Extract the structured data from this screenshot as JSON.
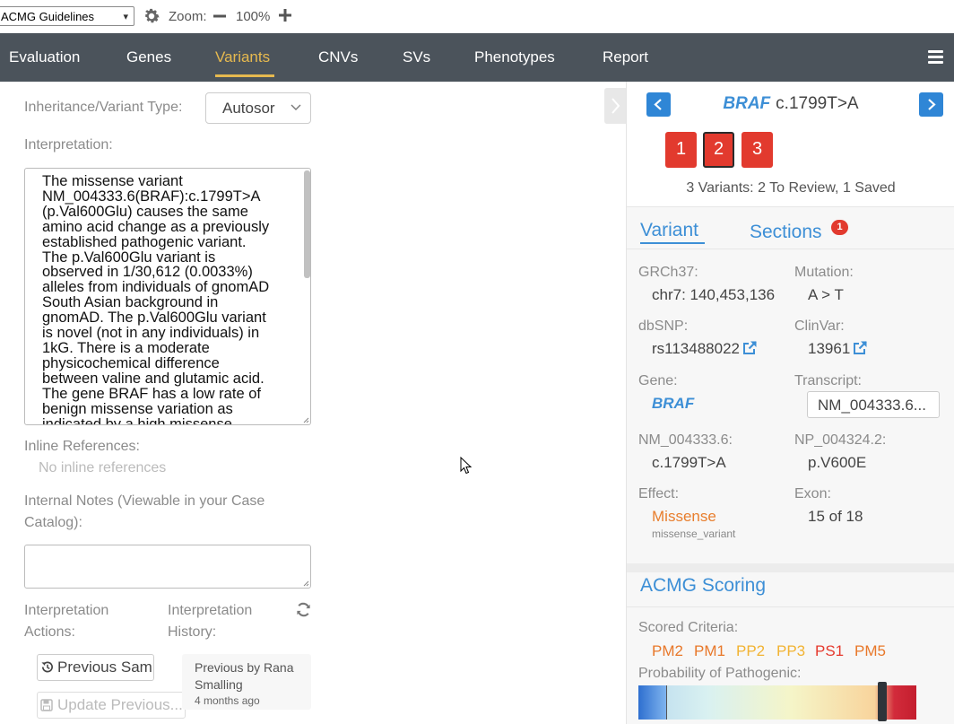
{
  "toolbar": {
    "guideline_select_value": "ACMG Guidelines",
    "zoom_label": "Zoom:",
    "zoom_value": "100%"
  },
  "nav": {
    "items": [
      "Evaluation",
      "Genes",
      "Variants",
      "CNVs",
      "SVs",
      "Phenotypes",
      "Report"
    ],
    "active": "Variants"
  },
  "form": {
    "inheritance_label": "Inheritance/Variant Type:",
    "inheritance_value": "Autosor",
    "interpretation_label": "Interpretation:",
    "interpretation_lines": [
      "The missense variant",
      "NM_004333.6(BRAF):c.1799T>A",
      "(p.Val600Glu) causes the same",
      "amino acid change as a previously",
      "established pathogenic variant.",
      "The p.Val600Glu variant is",
      "observed in 1/30,612 (0.0033%)",
      "alleles from individuals of gnomAD",
      "South Asian background in",
      "gnomAD. The p.Val600Glu variant",
      "is novel (not in any individuals) in",
      "1kG. There is a moderate",
      "physicochemical difference",
      "between valine and glutamic acid.",
      "The gene BRAF has a low rate of",
      "benign missense variation as",
      "indicated by a high missense"
    ],
    "inline_refs_label": "Inline References:",
    "no_inline_refs": "No inline references",
    "internal_notes_label_1": "Internal Notes (Viewable in your Case",
    "internal_notes_label_2": "Catalog):",
    "actions_label_1": "Interpretation",
    "actions_label_2": "Actions:",
    "history_label_1": "Interpretation",
    "history_label_2": "History:",
    "previous_samples_button": "Previous Samples",
    "update_previous_button": "Update Previous...",
    "history_entry_title": "Previous by Rana Smalling",
    "history_entry_time": "4 months ago"
  },
  "panel": {
    "gene": "BRAF",
    "hgvs": "c.1799T>A",
    "variant_buttons": [
      "1",
      "2",
      "3"
    ],
    "selected_variant": "2",
    "summary": "3 Variants: 2 To Review, 1 Saved",
    "tab_variant": "Variant",
    "tab_sections": "Sections",
    "sections_badge": "1",
    "details": {
      "grch37_label": "GRCh37:",
      "grch37_value": "chr7: 140,453,136",
      "mutation_label": "Mutation:",
      "mutation_value": "A > T",
      "dbsnp_label": "dbSNP:",
      "dbsnp_value": "rs113488022",
      "clinvar_label": "ClinVar:",
      "clinvar_value": "13961",
      "gene_label": "Gene:",
      "gene_value": "BRAF",
      "transcript_label": "Transcript:",
      "transcript_value": "NM_004333.6...",
      "nm_label": "NM_004333.6:",
      "nm_value": "c.1799T>A",
      "np_label": "NP_004324.2:",
      "np_value": "p.V600E",
      "effect_label": "Effect:",
      "effect_value": "Missense",
      "effect_sub": "missense_variant",
      "exon_label": "Exon:",
      "exon_value": "15 of 18"
    },
    "acmg_title": "ACMG Scoring",
    "scored_label": "Scored Criteria:",
    "criteria": [
      {
        "code": "PM2",
        "color": "#e8782a"
      },
      {
        "code": "PM1",
        "color": "#e8782a"
      },
      {
        "code": "PP2",
        "color": "#f2b332"
      },
      {
        "code": "PP3",
        "color": "#f2b332"
      },
      {
        "code": "PS1",
        "color": "#e53a2e"
      },
      {
        "code": "PM5",
        "color": "#e8782a"
      }
    ],
    "probability_label": "Probability of Pathogenic:"
  },
  "colors": {
    "nav_bg": "#4b535b",
    "nav_active": "#e6b94f",
    "accent_blue": "#3d8fd6",
    "variant_red": "#e23a2e"
  }
}
